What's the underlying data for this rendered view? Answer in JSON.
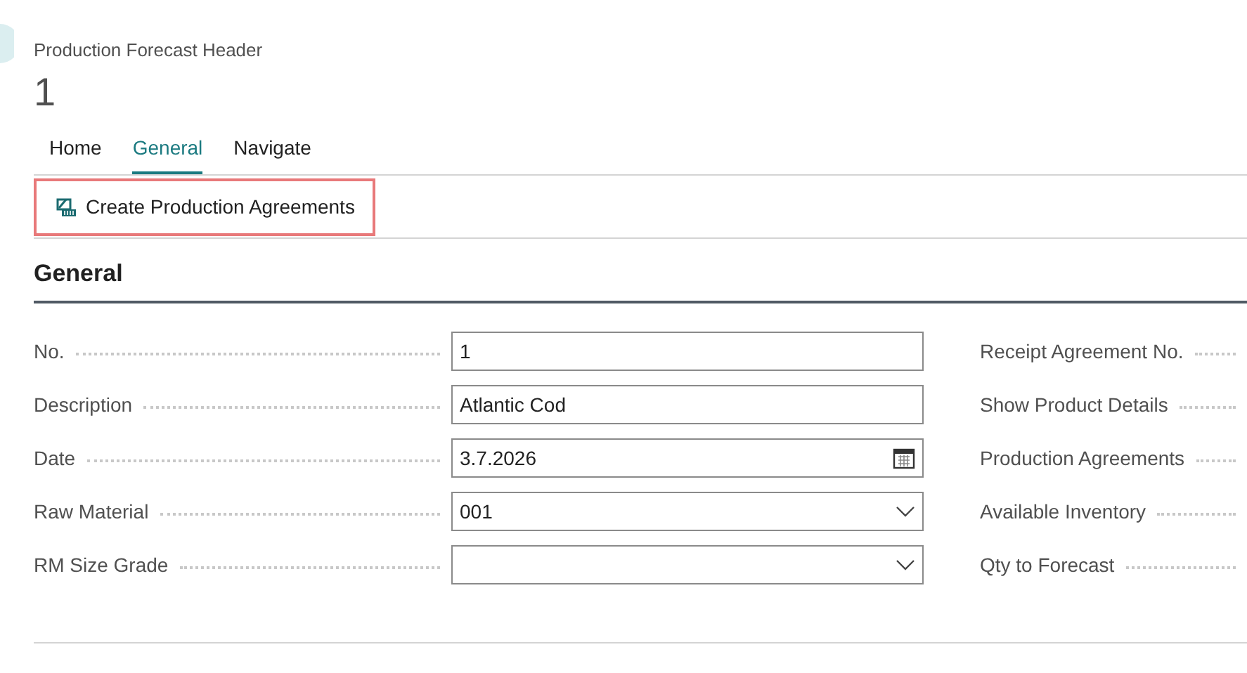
{
  "page": {
    "caption": "Production Forecast Header",
    "title": "1"
  },
  "tabs": [
    {
      "label": "Home",
      "selected": false
    },
    {
      "label": "General",
      "selected": true
    },
    {
      "label": "Navigate",
      "selected": false
    }
  ],
  "actions": [
    {
      "label": "Create Production Agreements",
      "highlighted": true
    }
  ],
  "section": {
    "title": "General",
    "left_fields": [
      {
        "label": "No.",
        "kind": "text",
        "value": "1"
      },
      {
        "label": "Description",
        "kind": "text",
        "value": "Atlantic Cod"
      },
      {
        "label": "Date",
        "kind": "date",
        "value": "3.7.2026"
      },
      {
        "label": "Raw Material",
        "kind": "select",
        "value": "001"
      },
      {
        "label": "RM Size Grade",
        "kind": "select"
      }
    ],
    "right_fields": [
      {
        "label": "Receipt Agreement No."
      },
      {
        "label": "Show Product Details"
      },
      {
        "label": "Production Agreements"
      },
      {
        "label": "Available Inventory"
      },
      {
        "label": "Qty to Forecast"
      }
    ]
  }
}
